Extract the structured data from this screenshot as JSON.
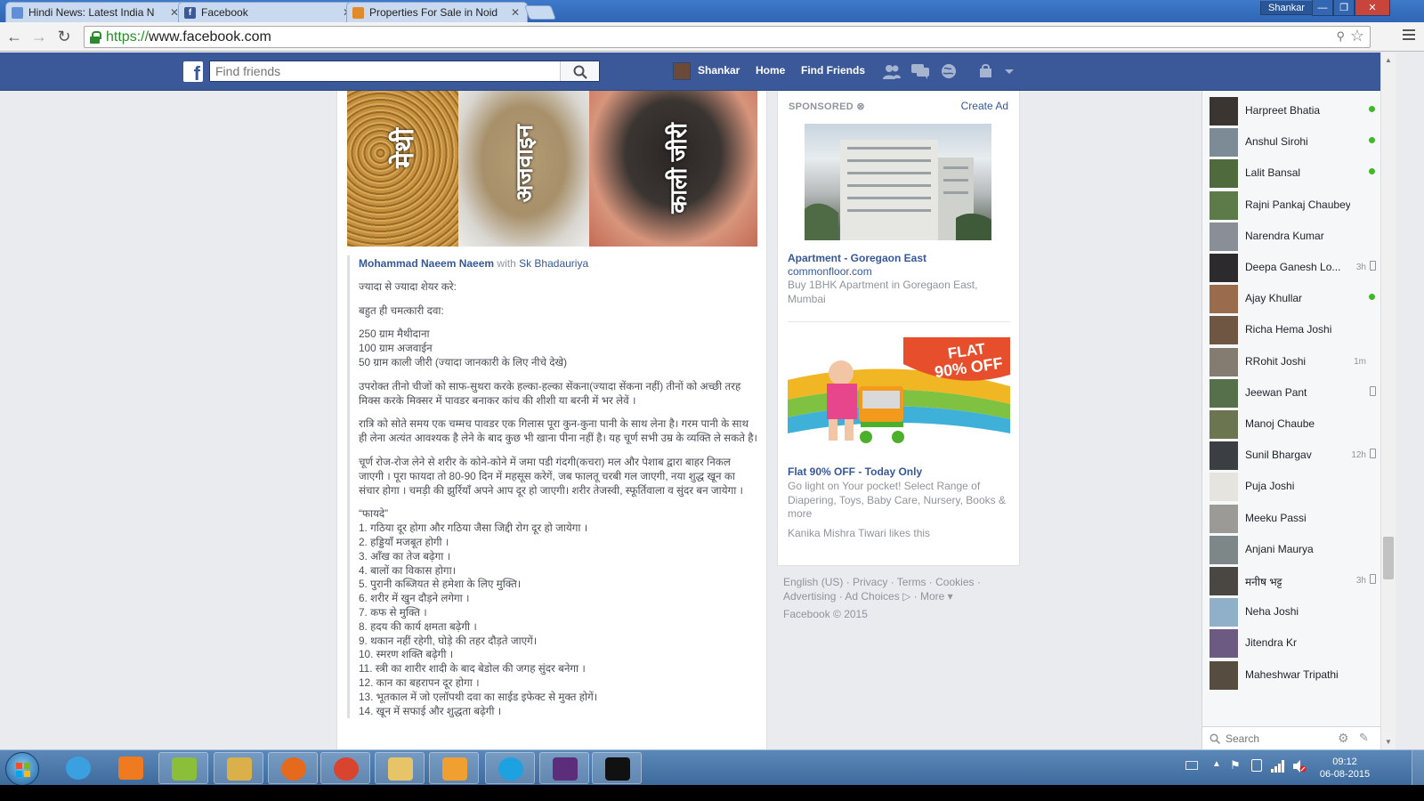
{
  "browser": {
    "tabs": [
      {
        "title": "Hindi News: Latest India N",
        "active": false,
        "favicon_color": "#5f8fd6"
      },
      {
        "title": "Facebook",
        "active": true,
        "favicon_color": "#3b5998"
      },
      {
        "title": "Properties For Sale in Noid",
        "active": false,
        "favicon_color": "#e08a2e"
      }
    ],
    "user": "Shankar",
    "url_scheme": "https://",
    "url_domain": "www.facebook.com"
  },
  "fb": {
    "search_placeholder": "Find friends",
    "profile_name": "Shankar",
    "nav_home": "Home",
    "nav_find_friends": "Find Friends"
  },
  "post": {
    "image_words": [
      "मेथी",
      "अजवाइन",
      "काली जीरी"
    ],
    "author": "Mohammad Naeem Naeem",
    "with_text": "with",
    "tagged": "Sk Bhadauriya",
    "paragraphs": [
      "ज्यादा से ज्यादा शेयर करे:",
      "बहुत ही चमत्कारी दवा:",
      "250 ग्राम मैथीदाना\n100 ग्राम अजवाईन\n50 ग्राम काली जीरी (ज्यादा जानकारी के लिए नीचे देखे)",
      "उपरोक्त तीनो चीजों को साफ-सुथरा करके हल्का-हल्का सेंकना(ज्यादा सेंकना नहीं) तीनों को अच्छी तरह मिक्स करके मिक्सर में पावडर बनाकर कांच की शीशी या बरनी में भर लेवें ।",
      "रात्रि को सोते समय एक चम्मच पावडर एक गिलास पूरा कुन-कुना पानी के साथ लेना है। गरम पानी के साथ ही लेना अत्यंत आवश्यक है लेने के बाद कुछ भी खाना पीना नहीं है। यह चूर्ण सभी उम्र के व्यक्ति ले सकते है।",
      "चूर्ण रोज-रोज लेने से शरीर के कोने-कोने में जमा पडी गंदगी(कचरा) मल और पेशाब द्वारा बाहर निकल जाएगी । पूरा फायदा तो 80-90 दिन में महसूस करेगें, जब फालतू चरबी गल जाएगी, नया शुद्ध खून का संचार होगा । चमड़ी की झुर्रियाँ अपने आप दूर हो जाएगी। शरीर तेजस्वी, स्फूर्तिवाला व सुंदर बन जायेगा ।"
    ],
    "benefits_heading": "“फायदे”",
    "benefits": [
      "1. गठिया दूर होगा और गठिया जैसा जिद्दी रोग दूर हो जायेगा ।",
      "2. हड्डियाँ मजबूत होगी ।",
      "3. आँख का तेज बढ़ेगा ।",
      "4. बालों का विकास होगा।",
      "5. पुरानी कब्जियत से हमेशा के लिए मुक्ति।",
      "6. शरीर में खुन दौड़ने लगेगा ।",
      "7. कफ से मुक्ति ।",
      "8. हदय की कार्य क्षमता बढ़ेगी ।",
      "9. थकान नहीं रहेगी, घोड़े की तहर दौड़ते जाएगें।",
      "10. स्मरण शक्ति बढ़ेगी ।",
      "11. स्त्री का शारीर शादी के बाद बेडोल की जगह सुंदर बनेगा ।",
      "12. कान का बहरापन दूर होगा ।",
      "13. भूतकाल में जो एलॉपथी दवा का साईड इफेक्ट से मुक्त होगें।",
      "14. खून में सफाई और शुद्धता बढ़ेगी ।"
    ]
  },
  "ads": {
    "sponsored_label": "SPONSORED",
    "create_ad": "Create Ad",
    "ad1": {
      "title": "Apartment - Goregaon East",
      "site": "commonfloor.com",
      "desc": "Buy 1BHK Apartment in Goregaon East, Mumbai"
    },
    "ad2": {
      "banner_line1": "FLAT",
      "banner_line2": "90% OFF",
      "title": "Flat 90% OFF - Today Only",
      "desc": "Go light on Your pocket! Select Range of Diapering, Toys, Baby Care, Nursery, Books & more",
      "social": "Kanika Mishra Tiwari likes this"
    }
  },
  "footer": {
    "links_line1": "English (US) · Privacy · Terms · Cookies ·",
    "links_line2": "Advertising · Ad Choices ▷ · More ▾",
    "copyright": "Facebook © 2015"
  },
  "chat": {
    "friends": [
      {
        "name": "Harpreet Bhatia",
        "status": "online",
        "time": "",
        "color": "#3a3530"
      },
      {
        "name": "Anshul Sirohi",
        "status": "online",
        "time": "",
        "color": "#7d8b96"
      },
      {
        "name": "Lalit Bansal",
        "status": "online",
        "time": "",
        "color": "#4f6a3d"
      },
      {
        "name": "Rajni Pankaj Chaubey",
        "status": "",
        "time": "",
        "color": "#5d7a49"
      },
      {
        "name": "Narendra Kumar",
        "status": "",
        "time": "",
        "color": "#8a8f97"
      },
      {
        "name": "Deepa Ganesh Lo...",
        "status": "mobile",
        "time": "3h",
        "color": "#2d2a2e"
      },
      {
        "name": "Ajay Khullar",
        "status": "online",
        "time": "",
        "color": "#9a6b4d"
      },
      {
        "name": "Richa Hema Joshi",
        "status": "",
        "time": "",
        "color": "#6e5642"
      },
      {
        "name": "RRohit Joshi",
        "status": "",
        "time": "1m",
        "color": "#847c70"
      },
      {
        "name": "Jeewan Pant",
        "status": "mobile",
        "time": "",
        "color": "#55704a"
      },
      {
        "name": "Manoj Chaube",
        "status": "",
        "time": "",
        "color": "#6b7550"
      },
      {
        "name": "Sunil Bhargav",
        "status": "mobile",
        "time": "12h",
        "color": "#3b3f44"
      },
      {
        "name": "Puja Joshi",
        "status": "",
        "time": "",
        "color": "#e6e4df"
      },
      {
        "name": "Meeku Passi",
        "status": "",
        "time": "",
        "color": "#9b9a96"
      },
      {
        "name": "Anjani Maurya",
        "status": "",
        "time": "",
        "color": "#7e8788"
      },
      {
        "name": "मनीष भट्ट",
        "status": "mobile",
        "time": "3h",
        "color": "#4a4742"
      },
      {
        "name": "Neha Joshi",
        "status": "",
        "time": "",
        "color": "#8fb0c8"
      },
      {
        "name": "Jitendra Kr",
        "status": "",
        "time": "",
        "color": "#6d5a82"
      },
      {
        "name": "Maheshwar Tripathi",
        "status": "",
        "time": "",
        "color": "#574c40"
      }
    ],
    "search_placeholder": "Search"
  },
  "taskbar": {
    "apps": [
      {
        "name": "ie-icon",
        "color": "#3aa0e0"
      },
      {
        "name": "media-player-icon",
        "color": "#f07a20"
      },
      {
        "name": "spreadsheet-app-icon",
        "color": "#8bbf3a"
      },
      {
        "name": "paint-icon",
        "color": "#d9b04a"
      },
      {
        "name": "firefox-icon",
        "color": "#e66a1c"
      },
      {
        "name": "chrome-icon",
        "color": "#d9442f"
      },
      {
        "name": "file-explorer-icon",
        "color": "#e8c468"
      },
      {
        "name": "outlook-icon",
        "color": "#f0a030"
      },
      {
        "name": "skype-icon",
        "color": "#1ea1e0"
      },
      {
        "name": "java-ee-ide-icon",
        "color": "#5b2d7a"
      },
      {
        "name": "command-prompt-icon",
        "color": "#111111"
      }
    ],
    "time": "09:12",
    "date": "06-08-2015"
  }
}
